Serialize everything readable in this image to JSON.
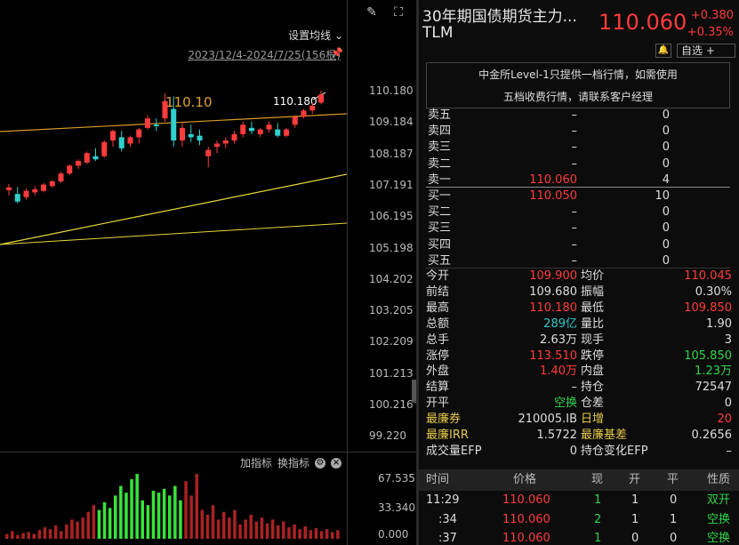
{
  "chart_header": {
    "ma_setting": "设置均线 ⌄",
    "date_range": "2023/12/4-2024/7/25(156根)",
    "peak_label": "110.10",
    "last_label": "110.180"
  },
  "price_axis": [
    "110.180",
    "109.184",
    "108.187",
    "107.191",
    "106.195",
    "105.198",
    "104.202",
    "103.205",
    "102.209",
    "101.213",
    "100.216",
    "99.220"
  ],
  "indicator_bar": {
    "add": "加指标",
    "switch": "换指标"
  },
  "volume_axis": [
    "67.535",
    "33.340",
    "0.000"
  ],
  "chart_data": {
    "type": "candlestick",
    "candles": [
      {
        "o": 107.02,
        "h": 107.22,
        "l": 106.85,
        "c": 107.11
      },
      {
        "o": 106.9,
        "h": 107.12,
        "l": 106.6,
        "c": 106.66
      },
      {
        "o": 106.8,
        "h": 107.08,
        "l": 106.72,
        "c": 107.0
      },
      {
        "o": 106.95,
        "h": 107.15,
        "l": 106.85,
        "c": 107.05
      },
      {
        "o": 107.0,
        "h": 107.25,
        "l": 106.95,
        "c": 107.2
      },
      {
        "o": 107.15,
        "h": 107.35,
        "l": 107.1,
        "c": 107.3
      },
      {
        "o": 107.3,
        "h": 107.6,
        "l": 107.25,
        "c": 107.55
      },
      {
        "o": 107.55,
        "h": 107.85,
        "l": 107.5,
        "c": 107.8
      },
      {
        "o": 107.8,
        "h": 108.0,
        "l": 107.7,
        "c": 107.95
      },
      {
        "o": 107.9,
        "h": 108.25,
        "l": 107.85,
        "c": 108.2
      },
      {
        "o": 108.1,
        "h": 108.35,
        "l": 107.95,
        "c": 108.0
      },
      {
        "o": 108.1,
        "h": 108.6,
        "l": 108.05,
        "c": 108.55
      },
      {
        "o": 108.6,
        "h": 108.95,
        "l": 108.4,
        "c": 108.9
      },
      {
        "o": 108.7,
        "h": 108.9,
        "l": 108.25,
        "c": 108.35
      },
      {
        "o": 108.5,
        "h": 108.75,
        "l": 108.4,
        "c": 108.7
      },
      {
        "o": 108.7,
        "h": 109.0,
        "l": 108.5,
        "c": 108.95
      },
      {
        "o": 109.0,
        "h": 109.4,
        "l": 108.95,
        "c": 109.3
      },
      {
        "o": 109.1,
        "h": 109.3,
        "l": 108.9,
        "c": 109.05
      },
      {
        "o": 109.3,
        "h": 110.1,
        "l": 109.2,
        "c": 109.85
      },
      {
        "o": 109.6,
        "h": 110.0,
        "l": 108.4,
        "c": 108.6
      },
      {
        "o": 108.6,
        "h": 109.2,
        "l": 108.4,
        "c": 109.0
      },
      {
        "o": 108.8,
        "h": 109.1,
        "l": 108.55,
        "c": 108.7
      },
      {
        "o": 108.75,
        "h": 108.95,
        "l": 108.45,
        "c": 108.6
      },
      {
        "o": 108.1,
        "h": 108.4,
        "l": 107.75,
        "c": 108.3
      },
      {
        "o": 108.4,
        "h": 108.6,
        "l": 108.2,
        "c": 108.5
      },
      {
        "o": 108.5,
        "h": 108.7,
        "l": 108.35,
        "c": 108.6
      },
      {
        "o": 108.6,
        "h": 108.9,
        "l": 108.5,
        "c": 108.8
      },
      {
        "o": 108.8,
        "h": 109.2,
        "l": 108.7,
        "c": 109.1
      },
      {
        "o": 109.0,
        "h": 109.2,
        "l": 108.8,
        "c": 108.9
      },
      {
        "o": 108.8,
        "h": 109.0,
        "l": 108.7,
        "c": 108.95
      },
      {
        "o": 108.95,
        "h": 109.2,
        "l": 108.85,
        "c": 109.1
      },
      {
        "o": 108.95,
        "h": 109.15,
        "l": 108.7,
        "c": 108.75
      },
      {
        "o": 108.75,
        "h": 109.0,
        "l": 108.7,
        "c": 108.95
      },
      {
        "o": 109.1,
        "h": 109.4,
        "l": 109.0,
        "c": 109.35
      },
      {
        "o": 109.35,
        "h": 109.6,
        "l": 109.3,
        "c": 109.55
      },
      {
        "o": 109.55,
        "h": 109.8,
        "l": 109.45,
        "c": 109.7
      },
      {
        "o": 109.8,
        "h": 110.18,
        "l": 109.75,
        "c": 110.06
      }
    ],
    "volume": [
      5,
      8,
      4,
      6,
      7,
      5,
      9,
      12,
      10,
      14,
      8,
      15,
      20,
      18,
      22,
      28,
      35,
      30,
      38,
      32,
      45,
      55,
      48,
      62,
      67.5,
      40,
      35,
      50,
      48,
      52,
      45,
      55,
      40,
      60,
      45,
      67.5,
      30,
      25,
      35,
      20,
      28,
      22,
      30,
      15,
      20,
      25,
      18,
      22,
      16,
      20,
      14,
      18,
      12,
      15,
      10,
      13,
      9,
      11,
      8,
      10,
      7,
      9
    ]
  },
  "quote": {
    "name": "30年期国债期货主力...",
    "code": "TLM",
    "last": "110.060",
    "change": "+0.380",
    "change_pct": "+0.35%",
    "watch_label": "自选 +",
    "bell": "🔔",
    "notice_l1": "中金所Level-1只提供一档行情，如需使用",
    "notice_l2": "五档收费行情，请联系客户经理"
  },
  "order_book": {
    "asks": [
      {
        "label": "卖五",
        "price": "–",
        "vol": "0"
      },
      {
        "label": "卖四",
        "price": "–",
        "vol": "0"
      },
      {
        "label": "卖三",
        "price": "–",
        "vol": "0"
      },
      {
        "label": "卖二",
        "price": "–",
        "vol": "0"
      },
      {
        "label": "卖一",
        "price": "110.060",
        "vol": "4"
      }
    ],
    "bids": [
      {
        "label": "买一",
        "price": "110.050",
        "vol": "10"
      },
      {
        "label": "买二",
        "price": "–",
        "vol": "0"
      },
      {
        "label": "买三",
        "price": "–",
        "vol": "0"
      },
      {
        "label": "买四",
        "price": "–",
        "vol": "0"
      },
      {
        "label": "买五",
        "price": "–",
        "vol": "0"
      }
    ]
  },
  "stats": [
    {
      "l1": "今开",
      "v1": "109.900",
      "c1": "red",
      "l2": "均价",
      "v2": "110.045",
      "c2": "red"
    },
    {
      "l1": "前结",
      "v1": "109.680",
      "c1": "w",
      "l2": "振幅",
      "v2": "0.30%",
      "c2": "w"
    },
    {
      "l1": "最高",
      "v1": "110.180",
      "c1": "red",
      "l2": "最低",
      "v2": "109.850",
      "c2": "red"
    },
    {
      "l1": "总额",
      "v1": "289亿",
      "c1": "cyan",
      "l2": "量比",
      "v2": "1.90",
      "c2": "w"
    },
    {
      "l1": "总手",
      "v1": "2.63万",
      "c1": "w",
      "l2": "现手",
      "v2": "3",
      "c2": "w"
    },
    {
      "l1": "涨停",
      "v1": "113.510",
      "c1": "red",
      "l2": "跌停",
      "v2": "105.850",
      "c2": "green"
    },
    {
      "l1": "外盘",
      "v1": "1.40万",
      "c1": "red",
      "l2": "内盘",
      "v2": "1.23万",
      "c2": "green"
    },
    {
      "l1": "结算",
      "v1": "–",
      "c1": "w",
      "l2": "持仓",
      "v2": "72547",
      "c2": "w"
    },
    {
      "l1": "开平",
      "v1": "空换",
      "c1": "green",
      "l2": "仓差",
      "v2": "0",
      "c2": "w"
    },
    {
      "l1": "最廉券",
      "v1": "210005.IB",
      "c1": "w",
      "l2": "日增",
      "v2": "20",
      "c2": "red",
      "yl": true
    },
    {
      "l1": "最廉IRR",
      "v1": "1.5722",
      "c1": "w",
      "l2": "最廉基差",
      "v2": "0.2656",
      "c2": "w",
      "yl": true
    },
    {
      "l1": "成交量EFP",
      "v1": "0",
      "c1": "w",
      "l2": "持仓变化EFP",
      "v2": "–",
      "c2": "w"
    }
  ],
  "trades_header": {
    "time": "时间",
    "price": "价格",
    "now": "现",
    "open": "开",
    "close": "平",
    "nature": "性质"
  },
  "trades": [
    {
      "time": "11:29",
      "price": "110.060",
      "now": "1",
      "open": "1",
      "close": "0",
      "nature": "双开"
    },
    {
      "time": ":34",
      "price": "110.060",
      "now": "2",
      "open": "1",
      "close": "1",
      "nature": "空换"
    },
    {
      "time": ":37",
      "price": "110.060",
      "now": "1",
      "open": "0",
      "close": "0",
      "nature": "空换"
    }
  ]
}
